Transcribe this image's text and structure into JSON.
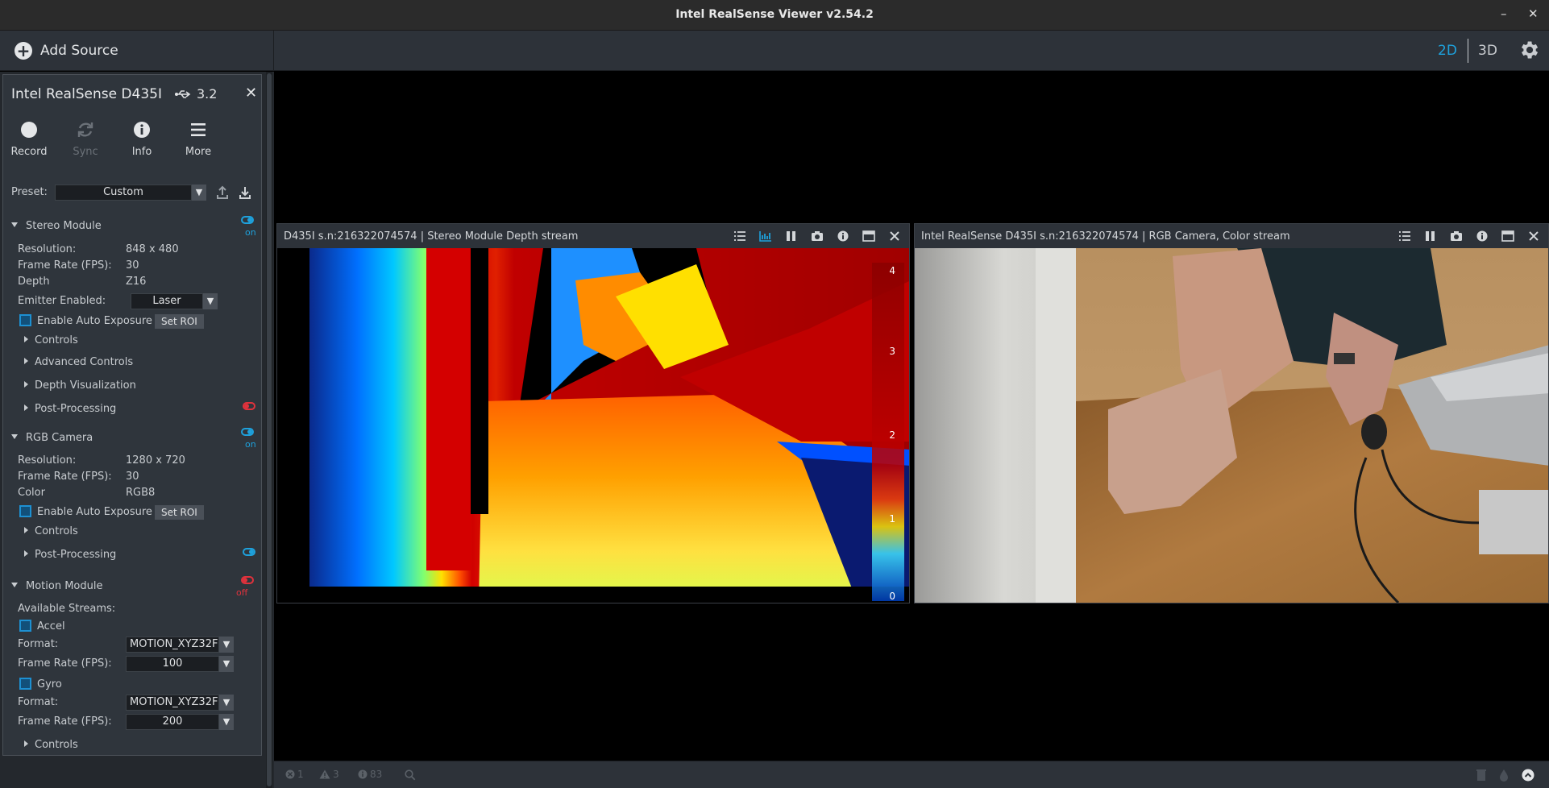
{
  "window": {
    "title": "Intel RealSense Viewer v2.54.2"
  },
  "toolbar": {
    "add_source": "Add Source",
    "mode_2d": "2D",
    "mode_3d": "3D"
  },
  "device": {
    "name": "Intel RealSense D435I",
    "usb": "3.2",
    "actions": {
      "record": "Record",
      "sync": "Sync",
      "info": "Info",
      "more": "More"
    },
    "preset_label": "Preset:",
    "preset_value": "Custom"
  },
  "stereo": {
    "title": "Stereo Module",
    "state": "on",
    "resolution_label": "Resolution:",
    "resolution": "848 x 480",
    "fps_label": "Frame Rate (FPS):",
    "fps": "30",
    "depth_label": "Depth",
    "depth": "Z16",
    "emitter_label": "Emitter Enabled:",
    "emitter": "Laser",
    "auto_exposure": "Enable Auto Exposure",
    "set_roi": "Set ROI",
    "controls": "Controls",
    "advanced": "Advanced Controls",
    "visualization": "Depth Visualization",
    "post": "Post-Processing"
  },
  "rgb": {
    "title": "RGB Camera",
    "state": "on",
    "resolution_label": "Resolution:",
    "resolution": "1280 x 720",
    "fps_label": "Frame Rate (FPS):",
    "fps": "30",
    "color_label": "Color",
    "color": "RGB8",
    "auto_exposure": "Enable Auto Exposure",
    "set_roi": "Set ROI",
    "controls": "Controls",
    "post": "Post-Processing"
  },
  "motion": {
    "title": "Motion Module",
    "state": "off",
    "available": "Available Streams:",
    "accel": "Accel",
    "format_label": "Format:",
    "accel_format": "MOTION_XYZ32F",
    "fps_label": "Frame Rate (FPS):",
    "accel_fps": "100",
    "gyro": "Gyro",
    "gyro_format": "MOTION_XYZ32F",
    "gyro_fps": "200",
    "controls": "Controls"
  },
  "streams": {
    "depth_title": "D435I s.n:216322074574 | Stereo Module Depth stream",
    "color_title": "Intel RealSense D435I s.n:216322074574 | RGB Camera, Color stream",
    "scale": [
      "4",
      "3",
      "2",
      "1",
      "0"
    ]
  },
  "status": {
    "errors": "1",
    "warnings": "3",
    "info": "83"
  },
  "colors": {
    "accent": "#1ea1dc",
    "off": "#e0323c",
    "panel": "#2f353c"
  }
}
